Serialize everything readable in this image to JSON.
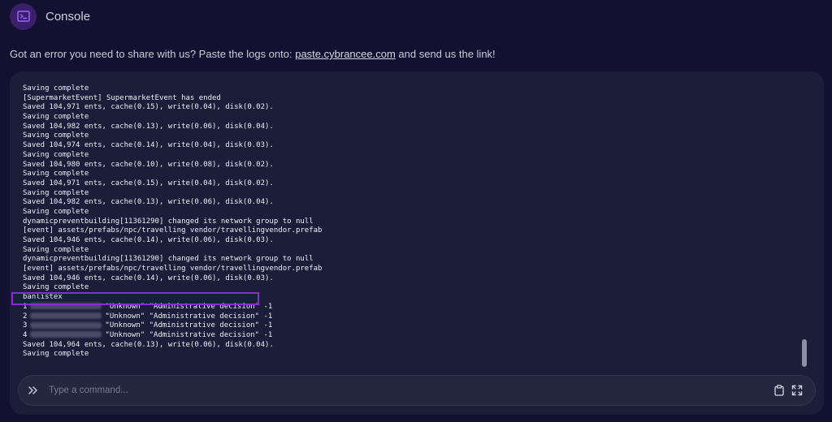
{
  "header": {
    "title": "Console",
    "icon": "terminal-icon"
  },
  "info": {
    "prefix": "Got an error you need to share with us? Paste the logs onto: ",
    "link": "paste.cybrancee.com",
    "suffix": " and send us the link!"
  },
  "log": {
    "lines": [
      "Saving complete",
      "[SupermarketEvent] SupermarketEvent has ended",
      "Saved 104,971 ents, cache(0.15), write(0.04), disk(0.02).",
      "Saving complete",
      "Saved 104,982 ents, cache(0.13), write(0.06), disk(0.04).",
      "Saving complete",
      "Saved 104,974 ents, cache(0.14), write(0.04), disk(0.03).",
      "Saving complete",
      "Saved 104,980 ents, cache(0.10), write(0.08), disk(0.02).",
      "Saving complete",
      "Saved 104,971 ents, cache(0.15), write(0.04), disk(0.02).",
      "Saving complete",
      "Saved 104,982 ents, cache(0.13), write(0.06), disk(0.04).",
      "Saving complete",
      "dynamicpreventbuilding[11361290] changed its network group to null",
      "[event] assets/prefabs/npc/travelling vendor/travellingvendor.prefab",
      "Saved 104,946 ents, cache(0.14), write(0.06), disk(0.03).",
      "Saving complete",
      "dynamicpreventbuilding[11361290] changed its network group to null",
      "[event] assets/prefabs/npc/travelling vendor/travellingvendor.prefab",
      "Saved 104,946 ents, cache(0.14), write(0.06), disk(0.03).",
      "Saving complete",
      "banlistex"
    ],
    "ban_entries": [
      {
        "num": "1",
        "rest": "\"Unknown\" \"Administrative decision\" -1"
      },
      {
        "num": "2",
        "rest": "\"Unknown\" \"Administrative decision\" -1"
      },
      {
        "num": "3",
        "rest": "\"Unknown\" \"Administrative decision\" -1"
      },
      {
        "num": "4",
        "rest": "\"Unknown\" \"Administrative decision\" -1"
      }
    ],
    "tail_lines": [
      "Saved 104,964 ents, cache(0.13), write(0.06), disk(0.04).",
      "Saving complete"
    ]
  },
  "command": {
    "placeholder": "Type a command..."
  },
  "colors": {
    "background": "#121230",
    "panel": "#1c1d38",
    "highlight": "#8b2bd6",
    "icon_bg": "#3a1f6a"
  }
}
